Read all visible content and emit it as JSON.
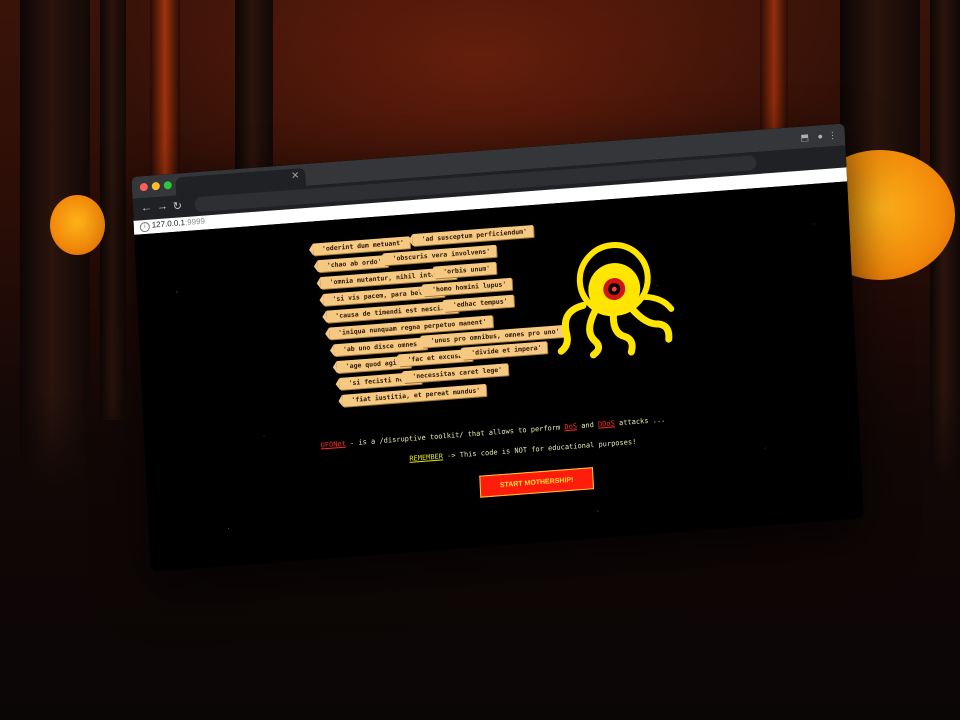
{
  "browser": {
    "url_host": "127.0.0.1",
    "url_port": ":9999"
  },
  "tags": [
    "'oderint dum metuant'",
    "'ad susceptum perficiendum'",
    "'chao ab ordo'",
    "'obscuris vera involvens'",
    "'omnia mutantur, nihil interit'",
    "'orbis unum'",
    "'si vis pacem, para bellum'",
    "'homo homini lupus'",
    "'causa de timendi est nescire'",
    "'edhac tempus'",
    "'iniqua nunquam regna perpetuo manent'",
    "'ab uno disce omnes'",
    "'unus pro omnibus, omnes pro uno'",
    "'age quod agis'",
    "'fac et excusa'",
    "'divide et impera'",
    "'si fecisti nega'",
    "'necessitas caret lege'",
    "'fiat iustitia, et pereat mundus'"
  ],
  "main": {
    "brand": "UFONet",
    "desc_part1": " - is a /disruptive toolkit/ that allows to perform ",
    "dos": "DoS",
    "desc_and": " and ",
    "ddos": "DDoS",
    "desc_end": " attacks ...",
    "remember": "REMEMBER",
    "remember_text": " -> This code is NOT for educational purposes!",
    "start_button": "START MOTHERSHIP!"
  },
  "colors": {
    "accent_red": "#ff1c0a",
    "tag_bg": "#f6c982",
    "logo_yellow": "#ffe500"
  }
}
